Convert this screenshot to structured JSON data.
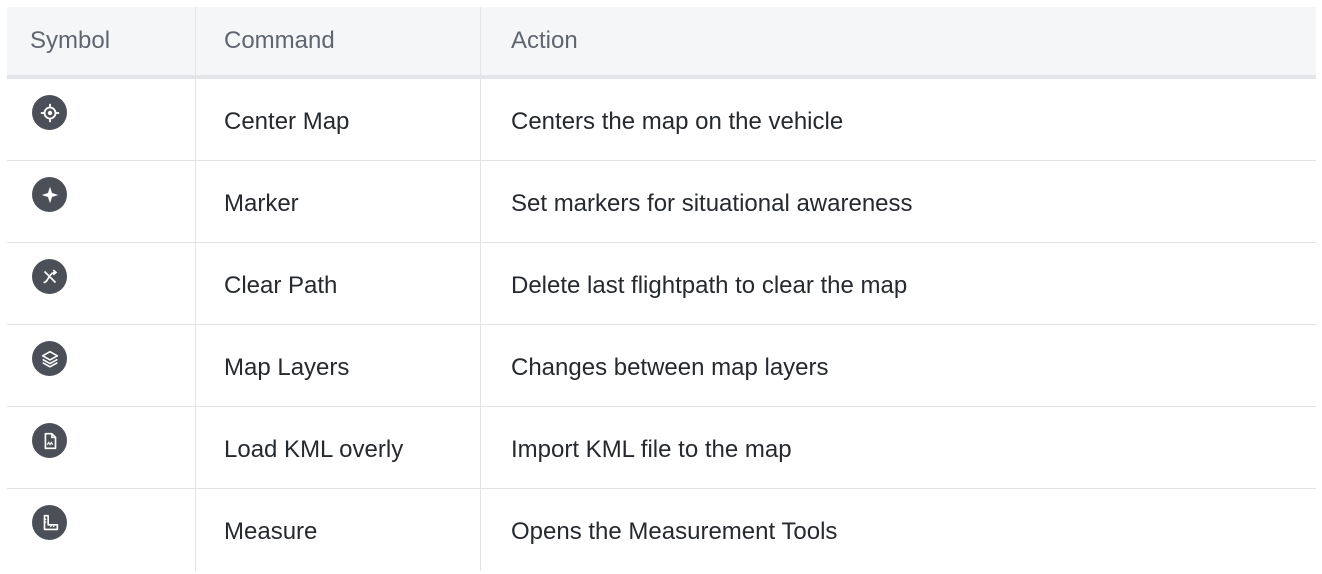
{
  "table": {
    "headers": [
      "Symbol",
      "Command",
      "Action"
    ],
    "rows": [
      {
        "icon": "center-map-icon",
        "command": "Center Map",
        "action": "Centers the map on the vehicle"
      },
      {
        "icon": "marker-icon",
        "command": "Marker",
        "action": "Set markers for situational awareness"
      },
      {
        "icon": "clear-path-icon",
        "command": "Clear Path",
        "action": "Delete last flightpath to clear the map"
      },
      {
        "icon": "map-layers-icon",
        "command": "Map Layers",
        "action": "Changes between map layers"
      },
      {
        "icon": "kml-file-icon",
        "command": "Load KML overly",
        "action": "Import KML file to the map"
      },
      {
        "icon": "measure-icon",
        "command": "Measure",
        "action": "Opens the Measurement Tools"
      }
    ]
  },
  "colors": {
    "icon_bg": "#4b5058",
    "header_bg": "#f5f6f8",
    "border": "#e1e3e6",
    "header_text": "#5f6670",
    "body_text": "#262a2e"
  }
}
